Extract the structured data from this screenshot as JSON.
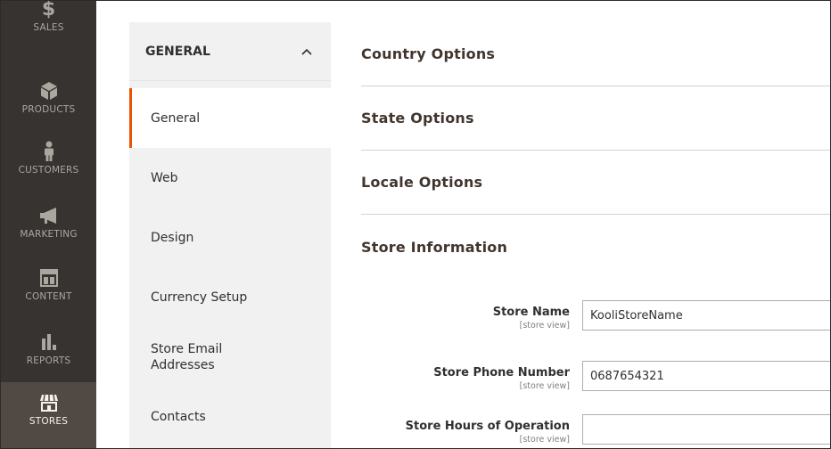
{
  "admin_nav": {
    "items": [
      {
        "key": "sales",
        "label": "SALES",
        "icon": "dollar-icon"
      },
      {
        "key": "products",
        "label": "PRODUCTS",
        "icon": "cube-icon"
      },
      {
        "key": "customers",
        "label": "CUSTOMERS",
        "icon": "person-icon"
      },
      {
        "key": "marketing",
        "label": "MARKETING",
        "icon": "megaphone-icon"
      },
      {
        "key": "content",
        "label": "CONTENT",
        "icon": "layout-icon"
      },
      {
        "key": "reports",
        "label": "REPORTS",
        "icon": "bar-chart-icon"
      },
      {
        "key": "stores",
        "label": "STORES",
        "icon": "storefront-icon",
        "active": true
      }
    ],
    "sales_glyph": "$",
    "colors": {
      "background": "#373330",
      "active": "#514943",
      "text": "#aaa6a0",
      "active_text": "#f7f3eb"
    }
  },
  "config_nav": {
    "group_title": "GENERAL",
    "collapse_icon": "chevron-up-icon",
    "items": [
      {
        "label": "General",
        "active": true
      },
      {
        "label": "Web"
      },
      {
        "label": "Design"
      },
      {
        "label": "Currency Setup"
      },
      {
        "label": "Store Email\nAddresses"
      },
      {
        "label": "Contacts"
      }
    ],
    "accent": "#eb5202"
  },
  "sections": [
    {
      "title": "Country Options"
    },
    {
      "title": "State Options"
    },
    {
      "title": "Locale Options"
    },
    {
      "title": "Store Information",
      "open": true
    }
  ],
  "store_information": {
    "fields": [
      {
        "label": "Store Name",
        "scope": "[store view]",
        "value": "KooliStoreName"
      },
      {
        "label": "Store Phone Number",
        "scope": "[store view]",
        "value": "0687654321"
      },
      {
        "label": "Store Hours of Operation",
        "scope": "[store view]",
        "value": ""
      }
    ]
  }
}
